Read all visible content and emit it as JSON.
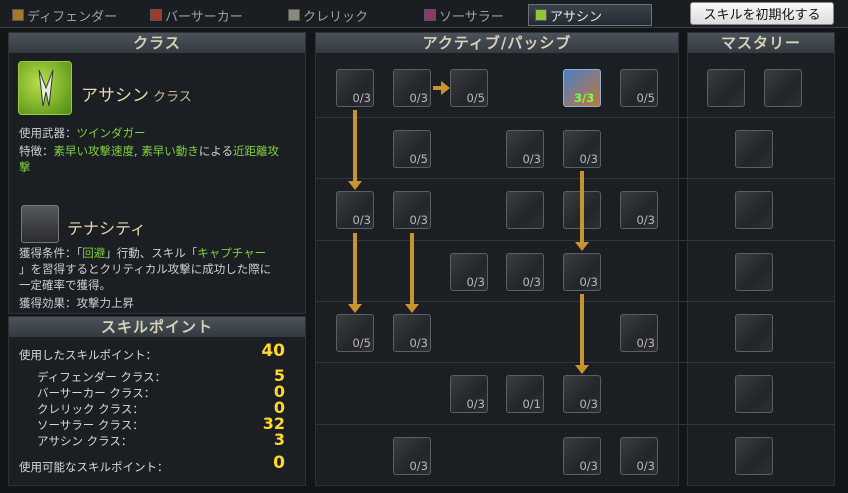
{
  "tabs": [
    {
      "label": "ディフェンダー",
      "icon": "defender-icon"
    },
    {
      "label": "バーサーカー",
      "icon": "berserker-icon"
    },
    {
      "label": "クレリック",
      "icon": "cleric-icon"
    },
    {
      "label": "ソーサラー",
      "icon": "sorcerer-icon"
    },
    {
      "label": "アサシン",
      "icon": "assassin-icon"
    }
  ],
  "reset_button": "スキルを初期化する",
  "class_panel": {
    "header": "クラス",
    "class_name": "アサシン",
    "class_suffix": "クラス",
    "weapon_label": "使用武器：",
    "weapon": "ツインダガー",
    "feature_label": "特徴：",
    "feature_a": "素早い攻撃速度",
    "feature_sep": ", ",
    "feature_b": "素早い動き",
    "feature_mid": "による",
    "feature_c": "近距離攻",
    "feature_c2": "撃",
    "passive_name": "テナシティ",
    "cond_label": "獲得条件：",
    "cond_q1": "「",
    "cond_kw": "回避",
    "cond_q2": "」行動、スキル「",
    "cond_skill": "キャプチャー",
    "cond_q3": "」",
    "cond_rest1": "を習得するとクリティカル攻撃に成功した際に",
    "cond_rest2": "一定確率で獲得。",
    "effect_label": "獲得効果：",
    "effect": "攻撃力上昇"
  },
  "skill_points": {
    "header": "スキルポイント",
    "used_label": "使用したスキルポイント：",
    "used_value": "40",
    "classes": [
      {
        "label": "ディフェンダー クラス：",
        "value": "5"
      },
      {
        "label": "バーサーカー クラス：",
        "value": "0"
      },
      {
        "label": "クレリック クラス：",
        "value": "0"
      },
      {
        "label": "ソーサラー クラス：",
        "value": "32"
      },
      {
        "label": "アサシン クラス：",
        "value": "3"
      }
    ],
    "available_label": "使用可能なスキルポイント：",
    "available_value": "0"
  },
  "active_header": "アクティブ/パッシブ",
  "mastery_header": "マスタリー",
  "skills": [
    {
      "level": "0/3"
    },
    {
      "level": "0/3"
    },
    {
      "level": "0/5"
    },
    {
      "level": "3/3"
    },
    {
      "level": "0/5"
    },
    {
      "level": "0/5"
    },
    {
      "level": "0/3"
    },
    {
      "level": "0/3"
    },
    {
      "level": "0/3"
    },
    {
      "level": "0/3"
    },
    {
      "level": ""
    },
    {
      "level": ""
    },
    {
      "level": "0/3"
    },
    {
      "level": "0/3"
    },
    {
      "level": "0/3"
    },
    {
      "level": "0/3"
    },
    {
      "level": "0/5"
    },
    {
      "level": "0/3"
    },
    {
      "level": "0/3"
    },
    {
      "level": "0/3"
    },
    {
      "level": "0/1"
    },
    {
      "level": "0/3"
    },
    {
      "level": "0/3"
    },
    {
      "level": "0/3"
    },
    {
      "level": "0/3"
    }
  ],
  "colors": {
    "accent_green": "#7fd23c",
    "accent_yellow": "#e8d34a",
    "points": "#ffd72a",
    "arrow": "#c89430"
  }
}
